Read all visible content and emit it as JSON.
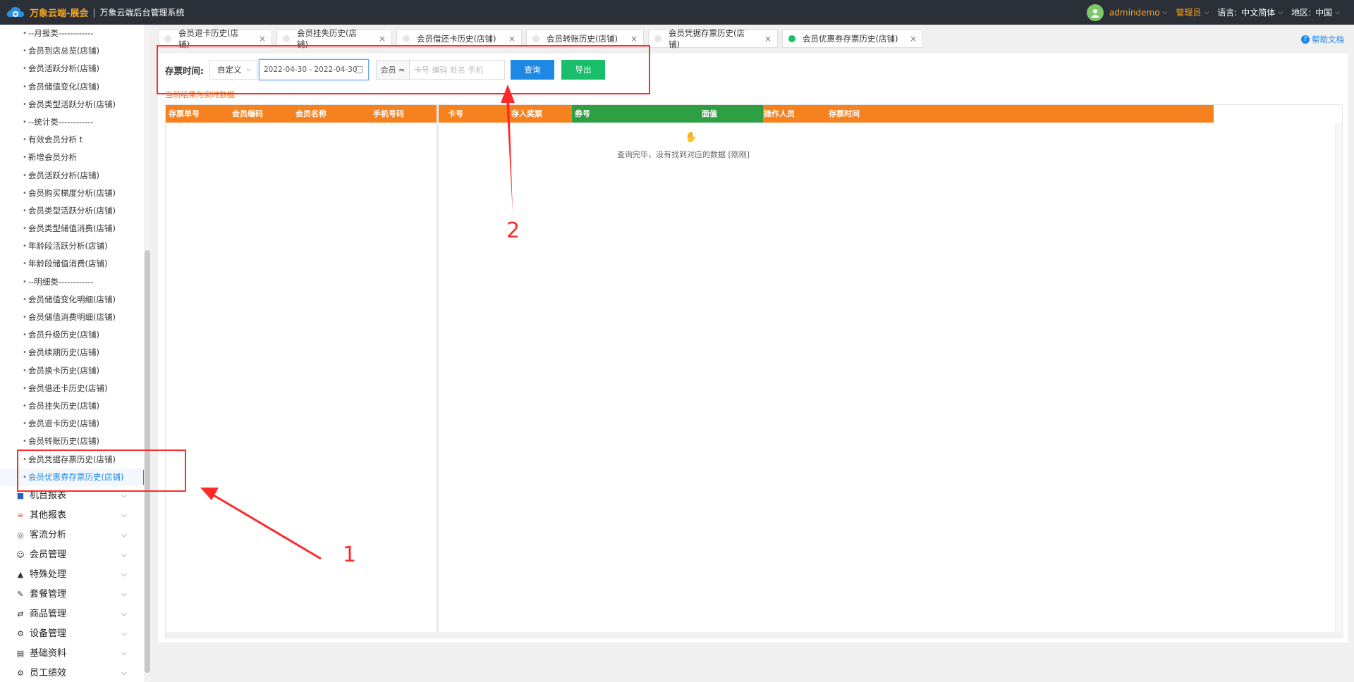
{
  "header": {
    "brand_name": "万象云端-展会",
    "separator": "|",
    "system_name": "万象云端后台管理系统",
    "user": "admindemo",
    "role": "管理员",
    "language_label": "语言:",
    "language_value": "中文简体",
    "region_label": "地区:",
    "region_value": "中国"
  },
  "sidebar": {
    "items": [
      {
        "label": "--月报类------------",
        "kind": "sub"
      },
      {
        "label": "会员到店总览(店铺)",
        "kind": "sub"
      },
      {
        "label": "会员活跃分析(店铺)",
        "kind": "sub"
      },
      {
        "label": "会员储值变化(店铺)",
        "kind": "sub"
      },
      {
        "label": "会员类型活跃分析(店铺)",
        "kind": "sub"
      },
      {
        "label": "--统计类------------",
        "kind": "sub"
      },
      {
        "label": "有效会员分析 t",
        "kind": "sub"
      },
      {
        "label": "新增会员分析",
        "kind": "sub"
      },
      {
        "label": "会员活跃分析(店铺)",
        "kind": "sub"
      },
      {
        "label": "会员购买梯度分析(店铺)",
        "kind": "sub"
      },
      {
        "label": "会员类型活跃分析(店铺)",
        "kind": "sub"
      },
      {
        "label": "会员类型储值消费(店铺)",
        "kind": "sub"
      },
      {
        "label": "年龄段活跃分析(店铺)",
        "kind": "sub"
      },
      {
        "label": "年龄段储值消费(店铺)",
        "kind": "sub"
      },
      {
        "label": "--明细类------------",
        "kind": "sub"
      },
      {
        "label": "会员储值变化明细(店铺)",
        "kind": "sub"
      },
      {
        "label": "会员储值消费明细(店铺)",
        "kind": "sub"
      },
      {
        "label": "会员升级历史(店铺)",
        "kind": "sub"
      },
      {
        "label": "会员续期历史(店铺)",
        "kind": "sub"
      },
      {
        "label": "会员换卡历史(店铺)",
        "kind": "sub"
      },
      {
        "label": "会员借还卡历史(店铺)",
        "kind": "sub"
      },
      {
        "label": "会员挂失历史(店铺)",
        "kind": "sub"
      },
      {
        "label": "会员退卡历史(店铺)",
        "kind": "sub"
      },
      {
        "label": "会员转账历史(店铺)",
        "kind": "sub"
      },
      {
        "label": "会员凭据存票历史(店铺)",
        "kind": "sub"
      },
      {
        "label": "会员优惠券存票历史(店铺)",
        "kind": "active"
      }
    ],
    "groups": [
      {
        "label": "机台报表",
        "icon": "chart-icon"
      },
      {
        "label": "其他报表",
        "icon": "layers-icon"
      },
      {
        "label": "客流分析",
        "icon": "target-icon"
      },
      {
        "label": "会员管理",
        "icon": "user-icon"
      },
      {
        "label": "特殊处理",
        "icon": "warning-icon"
      },
      {
        "label": "套餐管理",
        "icon": "edit-icon"
      },
      {
        "label": "商品管理",
        "icon": "swap-icon"
      },
      {
        "label": "设备管理",
        "icon": "device-icon"
      },
      {
        "label": "基础资料",
        "icon": "document-icon"
      },
      {
        "label": "员工绩效",
        "icon": "gear-icon"
      }
    ]
  },
  "tabs": [
    {
      "label": "会员退卡历史(店铺)",
      "active": false
    },
    {
      "label": "会员挂失历史(店铺)",
      "active": false
    },
    {
      "label": "会员借还卡历史(店铺)",
      "active": false
    },
    {
      "label": "会员转账历史(店铺)",
      "active": false
    },
    {
      "label": "会员凭据存票历史(店铺)",
      "active": false
    },
    {
      "label": "会员优惠券存票历史(店铺)",
      "active": true
    }
  ],
  "help_label": "帮助文档",
  "filter": {
    "label": "存票时间:",
    "mode_value": "自定义",
    "date_range": "2022-04-30 - 2022-04-30",
    "member_tag": "会员 ≈",
    "member_placeholder": "卡号 编码 姓名 手机",
    "query_button": "查询",
    "export_button": "导出"
  },
  "tip": "当前结果为实时数据",
  "table": {
    "columns": [
      "存票单号",
      "会员编码",
      "会员名称",
      "手机号码",
      "卡号",
      "存入奖票",
      "券号",
      "面值",
      "操作人员",
      "存票时间"
    ],
    "empty_message": "查询完毕，没有找到对应的数据 [刚刚]",
    "rows": []
  },
  "annotations": {
    "label_1": "1",
    "label_2": "2",
    "color": "#ff2a2a"
  },
  "colors": {
    "header_bg": "#2a2f38",
    "brand_accent": "#f5a623",
    "table_header_orange": "#f5821f",
    "table_header_green": "#2ea043",
    "query_blue": "#1e88e5",
    "export_green": "#19be6b"
  }
}
